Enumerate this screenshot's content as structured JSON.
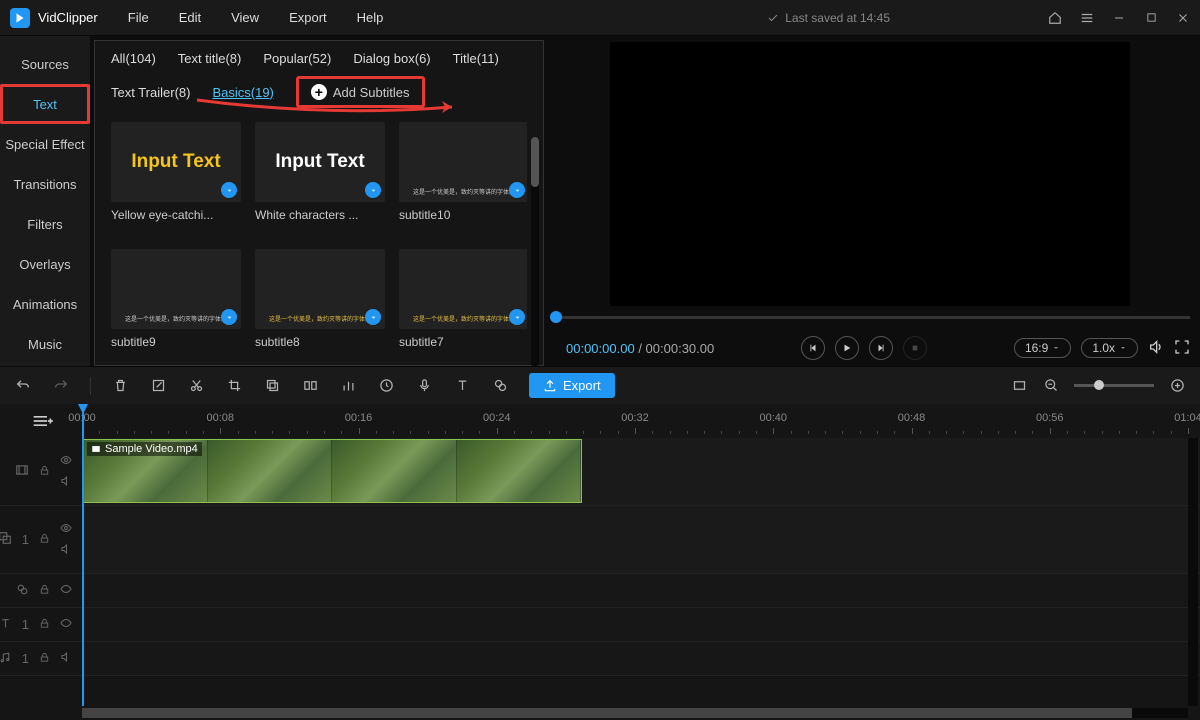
{
  "app": {
    "name": "VidClipper"
  },
  "menu": [
    "File",
    "Edit",
    "View",
    "Export",
    "Help"
  ],
  "titlebar": {
    "saved_text": "Last saved at 14:45"
  },
  "sidebar": [
    "Sources",
    "Text",
    "Special Effect",
    "Transitions",
    "Filters",
    "Overlays",
    "Animations",
    "Music"
  ],
  "text_panel": {
    "tabs_row1": [
      "All(104)",
      "Text title(8)",
      "Popular(52)",
      "Dialog box(6)"
    ],
    "tabs_row2": [
      "Title(11)",
      "Text Trailer(8)"
    ],
    "basics_tab": "Basics(19)",
    "add_subtitles": "Add Subtitles",
    "thumbs": [
      {
        "label": "Yellow eye-catchi...",
        "text": "Input Text",
        "color": "#f5c518",
        "type": "big"
      },
      {
        "label": "White characters ...",
        "text": "Input Text",
        "color": "#ffffff",
        "type": "big"
      },
      {
        "label": "subtitle10",
        "text": "这是一个优美是，致约灭等讲的字体效",
        "type": "sub"
      },
      {
        "label": "subtitle9",
        "text": "这是一个优美是，致约灭等讲的字体效",
        "type": "sub"
      },
      {
        "label": "subtitle8",
        "text": "这是一个优美是，致约灭等讲的字体效",
        "type": "sub",
        "subcolor": "#e6c24a"
      },
      {
        "label": "subtitle7",
        "text": "这是一个优美是，致约灭等讲的字体效",
        "type": "sub",
        "subcolor": "#e6c24a"
      }
    ]
  },
  "preview": {
    "current": "00:00:00.00",
    "duration": "00:00:30.00",
    "aspect": "16:9",
    "speed": "1.0x"
  },
  "toolbar": {
    "export": "Export"
  },
  "timeline": {
    "labels": [
      "00:00",
      "00:08",
      "00:16",
      "00:24",
      "00:32",
      "00:40",
      "00:48",
      "00:56",
      "01:04"
    ],
    "clip_name": "Sample Video.mp4",
    "track_nums": [
      "1",
      "1",
      "1"
    ]
  }
}
